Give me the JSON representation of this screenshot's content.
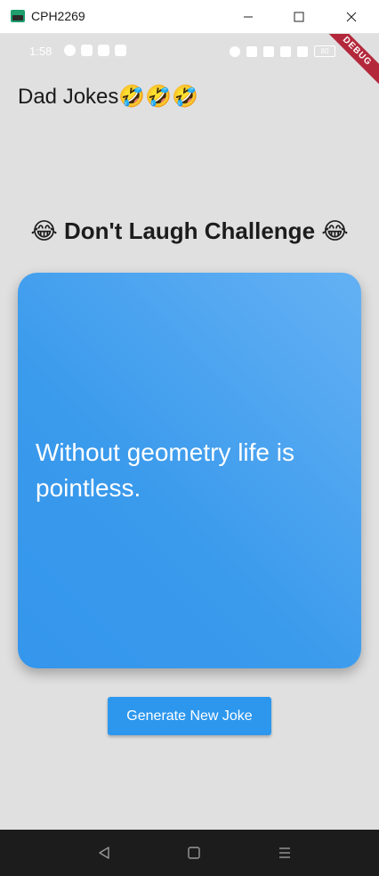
{
  "window": {
    "title": "CPH2269"
  },
  "statusbar": {
    "time": "1:58",
    "battery_label": "80"
  },
  "debug_banner": "DEBUG",
  "app": {
    "title": "Dad Jokes🤣🤣🤣"
  },
  "main": {
    "challenge_title": "😂 Don't Laugh Challenge 😂",
    "joke": "Without geometry life is pointless.",
    "generate_button": "Generate New Joke"
  },
  "colors": {
    "card_gradient_start": "#64b1f4",
    "card_gradient_end": "#3496ec",
    "button": "#2d97ee",
    "screen_background": "#e0e0e0",
    "debug_ribbon": "#b4283c",
    "navbar": "#1c1c1c"
  },
  "icons": {
    "window_controls": [
      "minimize-icon",
      "maximize-icon",
      "close-icon"
    ],
    "nav": [
      "back-icon",
      "home-icon",
      "menu-icon"
    ]
  }
}
